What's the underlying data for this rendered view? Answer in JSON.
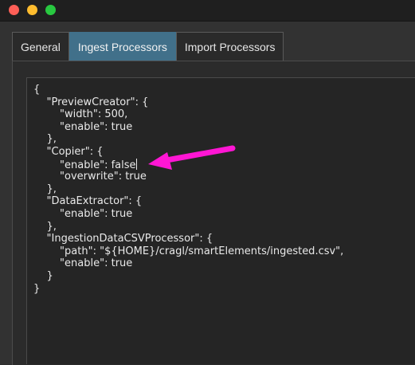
{
  "window": {
    "traffic_lights": [
      {
        "name": "close",
        "color": "#ff5f57"
      },
      {
        "name": "minimize",
        "color": "#febc2e"
      },
      {
        "name": "zoom",
        "color": "#28c840"
      }
    ]
  },
  "tabs": [
    {
      "label": "General",
      "active": false
    },
    {
      "label": "Ingest Processors",
      "active": true
    },
    {
      "label": "Import Processors",
      "active": false
    }
  ],
  "editor": {
    "lines": [
      "{",
      "    \"PreviewCreator\": {",
      "        \"width\": 500,",
      "        \"enable\": true",
      "    },",
      "    \"Copier\": {",
      "        \"enable\": false",
      "        \"overwrite\": true",
      "    },",
      "    \"DataExtractor\": {",
      "        \"enable\": true",
      "    },",
      "    \"IngestionDataCSVProcessor\": {",
      "        \"path\": \"${HOME}/cragl/smartElements/ingested.csv\",",
      "        \"enable\": true",
      "    }",
      "}"
    ]
  },
  "annotation": {
    "arrow_color": "#ff16d4",
    "points_to": "Copier.enable line"
  },
  "colors": {
    "active_tab": "#41708a",
    "background": "#2e2e2e",
    "editor_background": "#252525"
  }
}
